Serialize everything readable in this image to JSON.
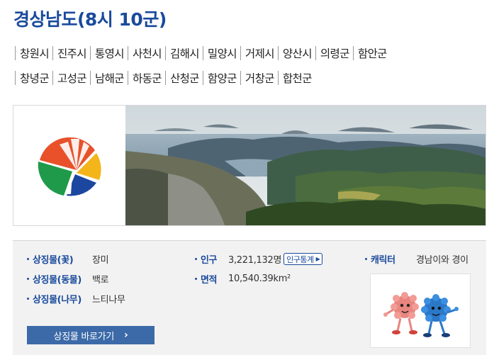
{
  "page": {
    "title": "경상남도(8시 10군)"
  },
  "districts": {
    "row1": [
      "창원시",
      "진주시",
      "통영시",
      "사천시",
      "김해시",
      "밀양시",
      "거제시",
      "양산시",
      "의령군",
      "함안군"
    ],
    "row2": [
      "창녕군",
      "고성군",
      "남해군",
      "하동군",
      "산청군",
      "함양군",
      "거창군",
      "합천군"
    ]
  },
  "symbols": {
    "flower_label": "상징물(꽃)",
    "flower_value": "장미",
    "animal_label": "상징물(동물)",
    "animal_value": "백로",
    "tree_label": "상징물(나무)",
    "tree_value": "느티나무"
  },
  "stats": {
    "population_label": "인구",
    "population_value": "3,221,132명",
    "population_link": "인구통계",
    "area_label": "면적",
    "area_value": "10,540.39km²"
  },
  "character": {
    "label": "캐릭터",
    "value": "경남이와 경이"
  },
  "cta": {
    "label": "상징물 바로가기"
  },
  "colors": {
    "accent": "#1a4a9c",
    "button": "#3c6aa8",
    "panel_bg": "#f2f2f2"
  }
}
